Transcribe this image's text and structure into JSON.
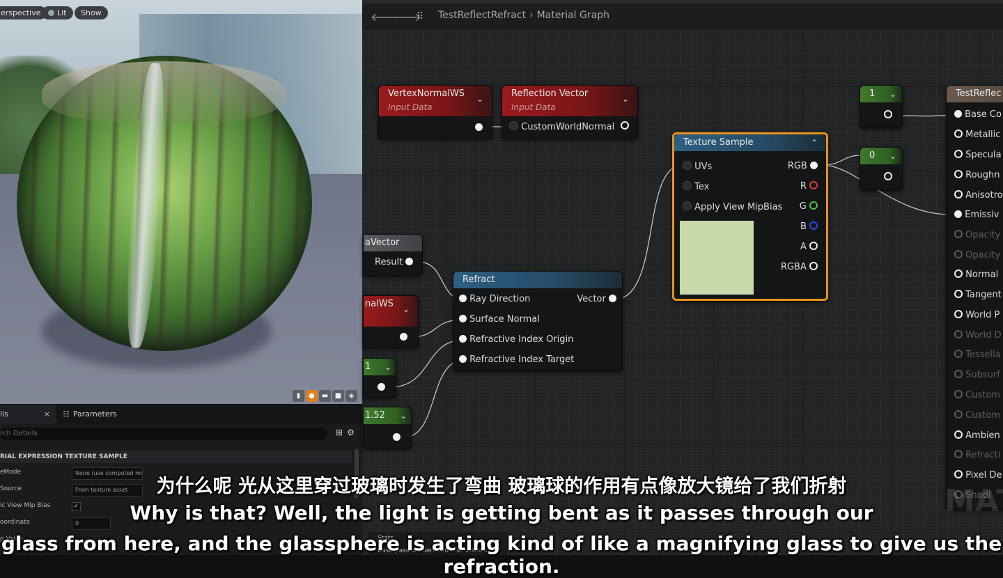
{
  "viewport": {
    "pills": [
      "erspective",
      "Lit",
      "Show"
    ]
  },
  "details": {
    "tab_details": "ils",
    "tab_parameters": "Parameters",
    "search_placeholder": "rch Details",
    "section_title": "RIAL EXPRESSION TEXTURE SAMPLE",
    "props": [
      {
        "label": "eMode",
        "value": "None (use computed mip level)"
      },
      {
        "label": "Source",
        "value": "From texture asset"
      },
      {
        "label": "ic View Mip Bias",
        "checked": true
      },
      {
        "label": "oordinate",
        "value": "0"
      },
      {
        "label": "p Value",
        "value": ""
      }
    ]
  },
  "graph": {
    "breadcrumb_root": "TestReflectRefract",
    "breadcrumb_page": "Material Graph",
    "nodes": {
      "vertex_normal": {
        "title": "VertexNormalWS",
        "subtitle": "Input Data"
      },
      "reflection_vector": {
        "title": "Reflection Vector",
        "subtitle": "Input Data",
        "input": "CustomWorldNormal"
      },
      "texture_sample": {
        "title": "Texture Sample",
        "inputs": [
          "UVs",
          "Tex",
          "Apply View MipBias"
        ],
        "outputs": [
          "RGB",
          "R",
          "G",
          "B",
          "A",
          "RGBA"
        ]
      },
      "const_1": {
        "value": "1"
      },
      "const_0": {
        "value": "0"
      },
      "camera_vector": {
        "title": "aVector",
        "output": "Result"
      },
      "normal_ws": {
        "title": "nalWS"
      },
      "refract": {
        "title": "Refract",
        "inputs": [
          "Ray Direction",
          "Surface Normal",
          "Refractive Index Origin",
          "Refractive Index Target"
        ],
        "output": "Vector"
      },
      "const_left_1": {
        "value": "1"
      },
      "const_152": {
        "value": "1.52"
      },
      "result": {
        "title": "TestReflec",
        "pins": [
          "Base Co",
          "Metallic",
          "Specula",
          "Roughn",
          "Anisotro",
          "Emissiv",
          "Opacity",
          "Opacity",
          "Normal",
          "Tangent",
          "World P",
          "World D",
          "Tessella",
          "Subsurf",
          "Custom",
          "Custom",
          "Ambien",
          "Refracti",
          "Pixel De",
          "Shadi"
        ]
      }
    },
    "watermark": "MAT",
    "stats_label": "Stats",
    "stats_value": "Base pass shader: 156 instructions"
  },
  "subtitles": {
    "zh": "为什么呢 光从这里穿过玻璃时发生了弯曲 玻璃球的作用有点像放大镜给了我们折射",
    "en_line1": "Why is that? Well, the light is getting bent as it passes through our",
    "en_line2": "glass from here, and the glassphere is acting kind of like a magnifying glass to give us the refraction."
  },
  "colors": {
    "selection": "#e8921d",
    "red_header": "#9a1b1d",
    "blue_header": "#2f5f82",
    "green_header": "#3f7a2e"
  }
}
